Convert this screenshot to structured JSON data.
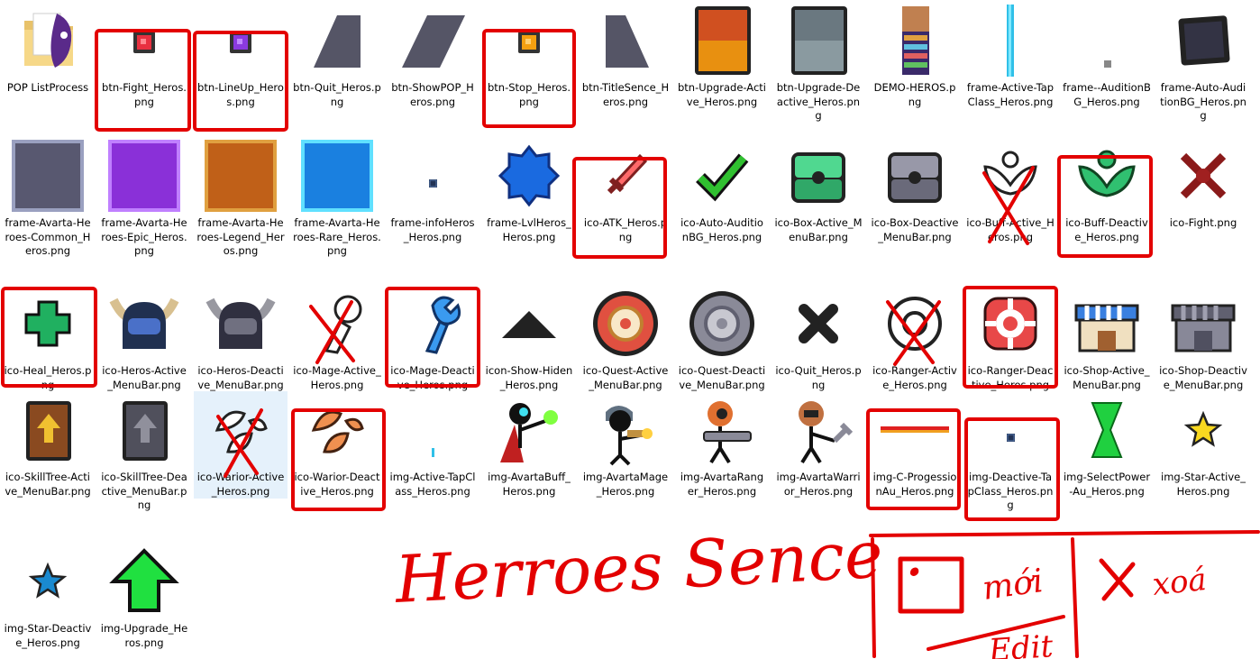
{
  "files": [
    {
      "name": "POP ListProcess",
      "icon": "folder-icon"
    },
    {
      "name": "btn-Fight_Heros.png",
      "icon": "red-square-button-icon"
    },
    {
      "name": "btn-LineUp_Heros.png",
      "icon": "purple-square-button-icon"
    },
    {
      "name": "btn-Quit_Heros.png",
      "icon": "dark-slanted-tab-icon"
    },
    {
      "name": "btn-ShowPOP_Heros.png",
      "icon": "dark-parallelogram-icon"
    },
    {
      "name": "btn-Stop_Heros.png",
      "icon": "yellow-square-button-icon"
    },
    {
      "name": "btn-TitleSence_Heros.png",
      "icon": "dark-trapezoid-tab-icon"
    },
    {
      "name": "btn-Upgrade-Active_Heros.png",
      "icon": "orange-card-icon"
    },
    {
      "name": "btn-Upgrade-Deactive_Heros.png",
      "icon": "gray-card-icon"
    },
    {
      "name": "DEMO-HEROS.png",
      "icon": "game-screenshot-icon"
    },
    {
      "name": "frame-Active-TapClass_Heros.png",
      "icon": "cyan-bar-icon"
    },
    {
      "name": "frame--AuditionBG_Heros.png",
      "icon": "tiny-gray-square-icon"
    },
    {
      "name": "frame-Auto-AuditionBG_Heros.png",
      "icon": "dark-framed-square-icon"
    },
    {
      "name": "frame-Avarta-Heroes-Common_Heros.png",
      "icon": "common-avatar-frame-icon"
    },
    {
      "name": "frame-Avarta-Heroes-Epic_Heros.png",
      "icon": "epic-avatar-frame-icon"
    },
    {
      "name": "frame-Avarta-Heroes-Legend_Heros.png",
      "icon": "legend-avatar-frame-icon"
    },
    {
      "name": "frame-Avarta-Heroes-Rare_Heros.png",
      "icon": "rare-avatar-frame-icon"
    },
    {
      "name": "frame-infoHeros_Heros.png",
      "icon": "tiny-navy-square-icon"
    },
    {
      "name": "frame-LvlHeros_Heros.png",
      "icon": "blue-badge-icon"
    },
    {
      "name": "ico-ATK_Heros.png",
      "icon": "sword-icon"
    },
    {
      "name": "ico-Auto-AuditionBG_Heros.png",
      "icon": "green-checkmark-icon"
    },
    {
      "name": "ico-Box-Active_MenuBar.png",
      "icon": "green-chest-icon"
    },
    {
      "name": "ico-Box-Deactive_MenuBar.png",
      "icon": "gray-chest-icon"
    },
    {
      "name": "ico-Buff-Active_Heros.png",
      "icon": "buff-wings-outline-icon"
    },
    {
      "name": "ico-Buff-Deactive_Heros.png",
      "icon": "buff-wings-green-icon"
    },
    {
      "name": "ico-Fight.png",
      "icon": "crossed-swords-icon"
    },
    {
      "name": "ico-Heal_Heros.png",
      "icon": "green-cross-icon"
    },
    {
      "name": "ico-Heros-Active_MenuBar.png",
      "icon": "blue-horned-helmet-icon"
    },
    {
      "name": "ico-Heros-Deactive_MenuBar.png",
      "icon": "gray-horned-helmet-icon"
    },
    {
      "name": "ico-Mage-Active_Heros.png",
      "icon": "mage-outline-icon"
    },
    {
      "name": "ico-Mage-Deactive_Heros.png",
      "icon": "blue-wrench-icon"
    },
    {
      "name": "icon-Show-Hiden_Heros.png",
      "icon": "dark-triangle-icon"
    },
    {
      "name": "ico-Quest-Active_MenuBar.png",
      "icon": "red-quest-medal-icon"
    },
    {
      "name": "ico-Quest-Deactive_MenuBar.png",
      "icon": "gray-quest-medal-icon"
    },
    {
      "name": "ico-Quit_Heros.png",
      "icon": "x-mark-icon"
    },
    {
      "name": "ico-Ranger-Active_Heros.png",
      "icon": "ranger-outline-icon"
    },
    {
      "name": "ico-Ranger-Deactive_Heros.png",
      "icon": "red-target-icon"
    },
    {
      "name": "ico-Shop-Active_MenuBar.png",
      "icon": "blue-shop-icon"
    },
    {
      "name": "ico-Shop-Deactive_MenuBar.png",
      "icon": "gray-shop-icon"
    },
    {
      "name": "ico-SkillTree-Active_MenuBar.png",
      "icon": "brown-book-icon"
    },
    {
      "name": "ico-SkillTree-Deactive_MenuBar.png",
      "icon": "gray-book-icon"
    },
    {
      "name": "ico-Warior-Active_Heros.png",
      "icon": "warrior-outline-icon"
    },
    {
      "name": "ico-Warior-Deactive_Heros.png",
      "icon": "orange-gauntlet-icon"
    },
    {
      "name": "img-Active-TapClass_Heros.png",
      "icon": "tiny-cyan-bar-icon"
    },
    {
      "name": "img-AvartaBuff_Heros.png",
      "icon": "stickman-buff-icon"
    },
    {
      "name": "img-AvartaMage_Heros.png",
      "icon": "stickman-mage-icon"
    },
    {
      "name": "img-AvartaRanger_Heros.png",
      "icon": "stickman-ranger-icon"
    },
    {
      "name": "img-AvartaWarrior_Heros.png",
      "icon": "stickman-warrior-icon"
    },
    {
      "name": "img-C-ProgessionAu_Heros.png",
      "icon": "progress-bar-strip-icon"
    },
    {
      "name": "img-Deactive-TapClass_Heros.png",
      "icon": "tiny-navy-square-icon"
    },
    {
      "name": "img-SelectPower-Au_Heros.png",
      "icon": "green-hourglass-icon"
    },
    {
      "name": "img-Star-Active_Heros.png",
      "icon": "yellow-star-icon"
    },
    {
      "name": "img-Star-Deactive_Heros.png",
      "icon": "blue-star-icon"
    },
    {
      "name": "img-Upgrade_Heros.png",
      "icon": "green-up-arrow-icon"
    }
  ],
  "notes": {
    "title": "Herroes Sence .",
    "new_label": "mới",
    "edit_label": "Edit",
    "delete_label": "xoá"
  },
  "colors": {
    "annotation": "#e30000",
    "selection": "#e5f1fb"
  }
}
